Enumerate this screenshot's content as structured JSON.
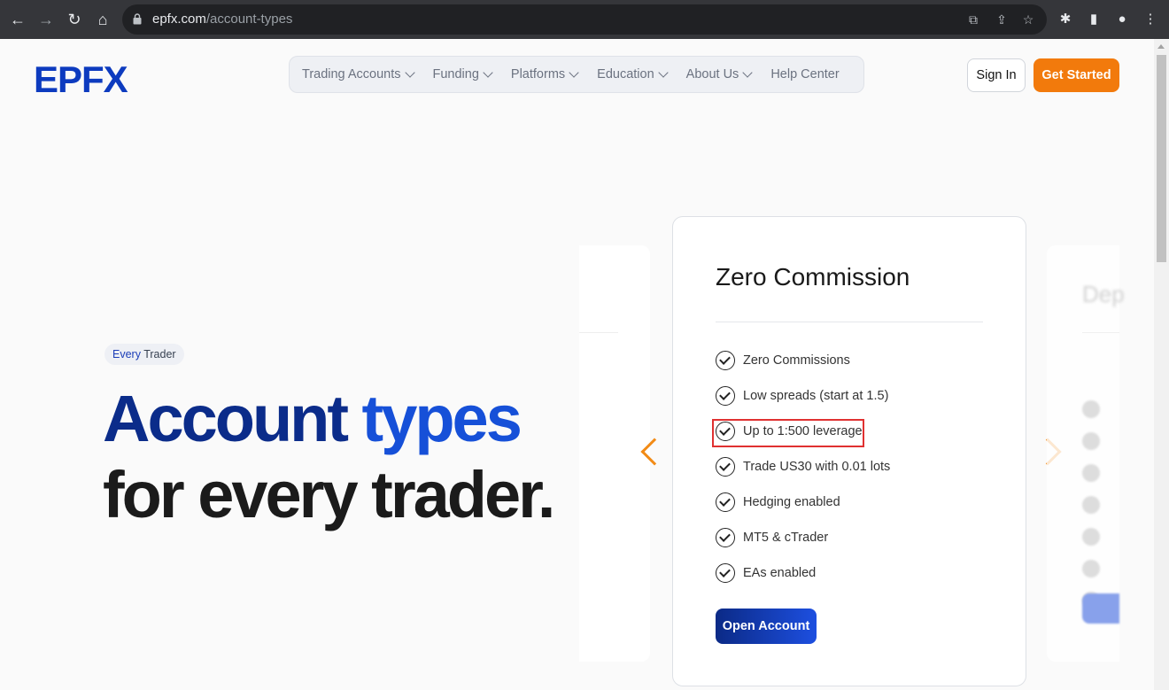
{
  "browser": {
    "url_domain": "epfx.com",
    "url_path": "/account-types"
  },
  "header": {
    "logo_text": "EPFX",
    "nav": [
      {
        "label": "Trading Accounts"
      },
      {
        "label": "Funding"
      },
      {
        "label": "Platforms"
      },
      {
        "label": "Education"
      },
      {
        "label": "About Us"
      },
      {
        "label": "Help Center"
      }
    ],
    "sign_in": "Sign In",
    "get_started": "Get Started"
  },
  "hero": {
    "badge_em": "Every",
    "badge_rest": " Trader",
    "line1_a": "Account",
    "line1_b": " types",
    "line2": "for every trader."
  },
  "card": {
    "title": "Zero Commission",
    "features": [
      "Zero Commissions",
      "Low spreads (start at 1.5)",
      "Up to 1:500 leverage",
      "Trade US30 with 0.01 lots",
      "Hedging enabled",
      "MT5 & cTrader",
      "EAs enabled"
    ],
    "highlighted_feature_index": 2,
    "button": "Open Account"
  },
  "next_card_title_partial": "Dep",
  "colors": {
    "brand_blue": "#0d3bbf",
    "accent_orange": "#f27a0c",
    "highlight_red": "#e03131"
  }
}
